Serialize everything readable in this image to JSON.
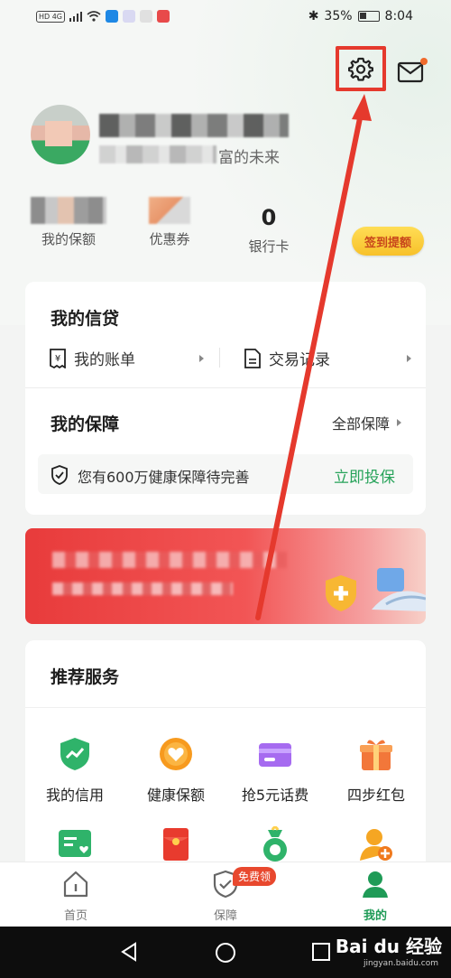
{
  "status_bar": {
    "network": "HD 4G",
    "battery": "35%",
    "time": "8:04"
  },
  "header": {
    "settings_icon": "gear-icon",
    "mail_icon": "mail-icon"
  },
  "profile": {
    "slogan_visible": "富的未来"
  },
  "stats": {
    "guarantee_label": "我的保额",
    "coupon_label": "优惠券",
    "bank_card_value": "0",
    "bank_card_label": "银行卡",
    "signin_label": "签到提额"
  },
  "credit": {
    "title": "我的信贷",
    "bill_label": "我的账单",
    "transactions_label": "交易记录"
  },
  "protection": {
    "title": "我的保障",
    "all_label": "全部保障",
    "health_text": "您有600万健康保障待完善",
    "insure_label": "立即投保"
  },
  "services": {
    "title": "推荐服务",
    "items": [
      {
        "label": "我的信用",
        "icon": "shield-chart-icon"
      },
      {
        "label": "健康保额",
        "icon": "heart-coin-icon"
      },
      {
        "label": "抢5元话费",
        "icon": "purple-card-icon"
      },
      {
        "label": "四步红包",
        "icon": "gift-icon"
      },
      {
        "label": "",
        "icon": "green-card-icon"
      },
      {
        "label": "",
        "icon": "red-envelope-icon"
      },
      {
        "label": "",
        "icon": "money-bag-icon"
      },
      {
        "label": "",
        "icon": "person-add-icon"
      }
    ]
  },
  "bottom_nav": {
    "home_label": "首页",
    "protection_label": "保障",
    "free_badge": "免费领",
    "me_label": "我的"
  },
  "watermark": {
    "text": "Bai du 经验",
    "url": "jingyan.baidu.com"
  },
  "colors": {
    "accent_green": "#27a35a",
    "highlight_red": "#e5392d",
    "signin_yellow": "#f7c12a"
  }
}
